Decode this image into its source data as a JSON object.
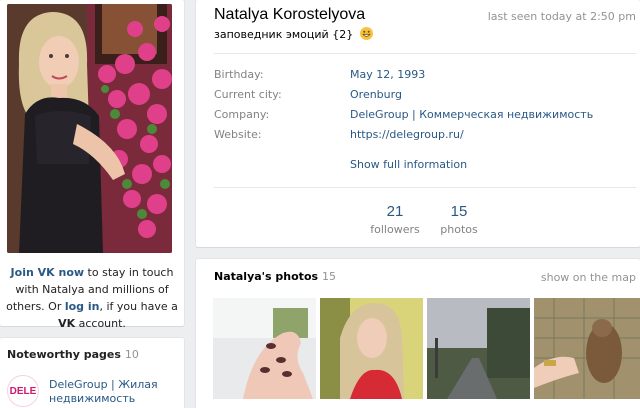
{
  "sidebar": {
    "join_prefix": "Join VK now",
    "join_middle": " to stay in touch with Natalya and millions of others. Or ",
    "login": "log in",
    "join_suffix_1": ", if you have a ",
    "vk": "VK",
    "join_suffix_2": " account.",
    "noteworthy_title": "Noteworthy pages",
    "noteworthy_count": "10",
    "page_logo": "DELE",
    "page_name": "DeleGroup | Жилая недвижимость"
  },
  "profile": {
    "name": "Natalya Korostelyova",
    "last_seen": "last seen today at 2:50 pm",
    "status": "заповедник эмоций {2}",
    "info": [
      {
        "label": "Birthday:",
        "value": "May 12, 1993"
      },
      {
        "label": "Current city:",
        "value": "Orenburg"
      },
      {
        "label": "Company:",
        "value": "DeleGroup | Коммерческая недвижимость"
      },
      {
        "label": "Website:",
        "value": "https://delegroup.ru/"
      }
    ],
    "show_full": "Show full information",
    "counters": [
      {
        "num": "21",
        "label": "followers"
      },
      {
        "num": "15",
        "label": "photos"
      }
    ]
  },
  "photos": {
    "title": "Natalya's photos",
    "count": "15",
    "show_map": "show on the map"
  },
  "colors": {
    "link": "#2a5885",
    "muted": "#828282",
    "background": "#edeef0"
  }
}
